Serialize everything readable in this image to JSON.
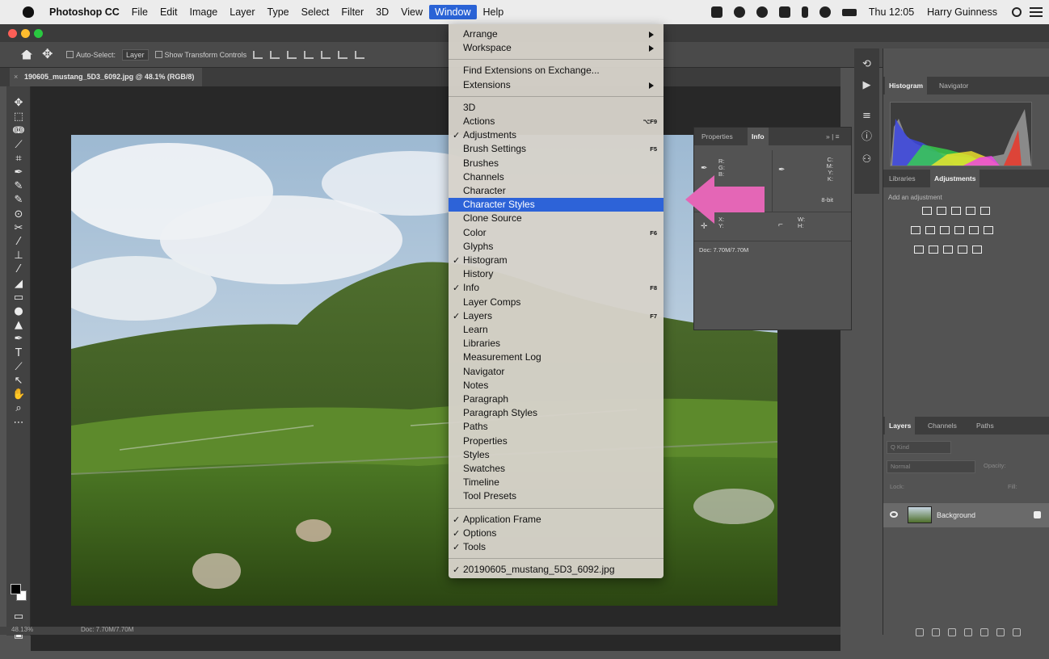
{
  "menubar": {
    "app_name": "Photoshop CC",
    "items": [
      "File",
      "Edit",
      "Image",
      "Layer",
      "Type",
      "Select",
      "Filter",
      "3D",
      "View",
      "Window",
      "Help"
    ],
    "active_item": "Window",
    "clock": "Thu 12:05",
    "user": "Harry Guinness"
  },
  "options_bar": {
    "auto_select_label": "Auto-Select:",
    "auto_select_value": "Layer",
    "transform_label": "Show Transform Controls"
  },
  "document": {
    "tab_title": "190605_mustang_5D3_6092.jpg @ 48.1% (RGB/8)"
  },
  "status_bar": {
    "zoom": "48.13%",
    "doc_size": "Doc: 7.70M/7.70M"
  },
  "window_menu": {
    "groups": [
      [
        {
          "label": "Arrange",
          "checked": false,
          "shortcut": "",
          "submenu": true
        },
        {
          "label": "Workspace",
          "checked": false,
          "shortcut": "",
          "submenu": true
        }
      ],
      [
        {
          "label": "Find Extensions on Exchange...",
          "checked": false,
          "shortcut": "",
          "submenu": false
        },
        {
          "label": "Extensions",
          "checked": false,
          "shortcut": "",
          "submenu": true
        }
      ],
      [
        {
          "label": "3D",
          "checked": false,
          "shortcut": "",
          "submenu": false
        },
        {
          "label": "Actions",
          "checked": false,
          "shortcut": "⌥F9",
          "submenu": false
        },
        {
          "label": "Adjustments",
          "checked": true,
          "shortcut": "",
          "submenu": false
        },
        {
          "label": "Brush Settings",
          "checked": false,
          "shortcut": "F5",
          "submenu": false
        },
        {
          "label": "Brushes",
          "checked": false,
          "shortcut": "",
          "submenu": false
        },
        {
          "label": "Channels",
          "checked": false,
          "shortcut": "",
          "submenu": false
        },
        {
          "label": "Character",
          "checked": false,
          "shortcut": "",
          "submenu": false
        },
        {
          "label": "Character Styles",
          "checked": false,
          "shortcut": "",
          "submenu": false,
          "highlighted": true
        },
        {
          "label": "Clone Source",
          "checked": false,
          "shortcut": "",
          "submenu": false
        },
        {
          "label": "Color",
          "checked": false,
          "shortcut": "F6",
          "submenu": false
        },
        {
          "label": "Glyphs",
          "checked": false,
          "shortcut": "",
          "submenu": false
        },
        {
          "label": "Histogram",
          "checked": true,
          "shortcut": "",
          "submenu": false
        },
        {
          "label": "History",
          "checked": false,
          "shortcut": "",
          "submenu": false
        },
        {
          "label": "Info",
          "checked": true,
          "shortcut": "F8",
          "submenu": false
        },
        {
          "label": "Layer Comps",
          "checked": false,
          "shortcut": "",
          "submenu": false
        },
        {
          "label": "Layers",
          "checked": true,
          "shortcut": "F7",
          "submenu": false
        },
        {
          "label": "Learn",
          "checked": false,
          "shortcut": "",
          "submenu": false
        },
        {
          "label": "Libraries",
          "checked": false,
          "shortcut": "",
          "submenu": false
        },
        {
          "label": "Measurement Log",
          "checked": false,
          "shortcut": "",
          "submenu": false
        },
        {
          "label": "Navigator",
          "checked": false,
          "shortcut": "",
          "submenu": false
        },
        {
          "label": "Notes",
          "checked": false,
          "shortcut": "",
          "submenu": false
        },
        {
          "label": "Paragraph",
          "checked": false,
          "shortcut": "",
          "submenu": false
        },
        {
          "label": "Paragraph Styles",
          "checked": false,
          "shortcut": "",
          "submenu": false
        },
        {
          "label": "Paths",
          "checked": false,
          "shortcut": "",
          "submenu": false
        },
        {
          "label": "Properties",
          "checked": false,
          "shortcut": "",
          "submenu": false
        },
        {
          "label": "Styles",
          "checked": false,
          "shortcut": "",
          "submenu": false
        },
        {
          "label": "Swatches",
          "checked": false,
          "shortcut": "",
          "submenu": false
        },
        {
          "label": "Timeline",
          "checked": false,
          "shortcut": "",
          "submenu": false
        },
        {
          "label": "Tool Presets",
          "checked": false,
          "shortcut": "",
          "submenu": false
        }
      ],
      [
        {
          "label": "Application Frame",
          "checked": true,
          "shortcut": "",
          "submenu": false
        },
        {
          "label": "Options",
          "checked": true,
          "shortcut": "",
          "submenu": false
        },
        {
          "label": "Tools",
          "checked": true,
          "shortcut": "",
          "submenu": false
        }
      ],
      [
        {
          "label": "20190605_mustang_5D3_6092.jpg",
          "checked": true,
          "shortcut": "",
          "submenu": false
        }
      ]
    ]
  },
  "info_panel": {
    "tabs": [
      "Properties",
      "Info"
    ],
    "active_tab": "Info",
    "rgb_labels": "R:\nG:\nB:",
    "cmyk_labels": "C:\nM:\nY:\nK:",
    "bit_depth": "8-bit",
    "xy_labels": "X:\nY:",
    "wh_labels": "W:\nH:",
    "doc_info": "Doc: 7.70M/7.70M"
  },
  "panels": {
    "histogram_tabs": [
      "Histogram",
      "Navigator"
    ],
    "adjust_tabs": [
      "Libraries",
      "Adjustments"
    ],
    "adjust_hint": "Add an adjustment",
    "layer_tabs": [
      "Layers",
      "Channels",
      "Paths"
    ],
    "layer_kind_placeholder": "Q Kind",
    "blend_mode": "Normal",
    "opacity_label": "Opacity:",
    "lock_label": "Lock:",
    "fill_label": "Fill:",
    "layer_name": "Background"
  },
  "colors": {
    "menu_highlight": "#2d63d8",
    "annotation_arrow": "#e466b6"
  }
}
